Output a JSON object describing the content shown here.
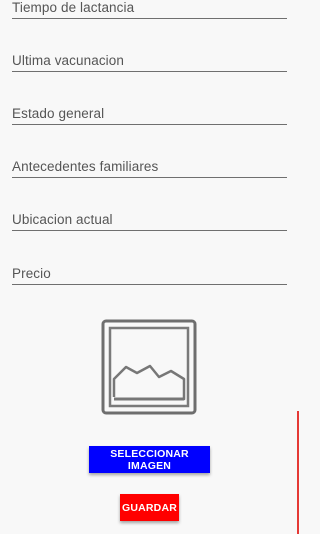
{
  "form": {
    "fields": [
      {
        "placeholder": "Tiempo de lactancia",
        "value": ""
      },
      {
        "placeholder": "Ultima vacunacion",
        "value": ""
      },
      {
        "placeholder": "Estado general",
        "value": ""
      },
      {
        "placeholder": "Antecedentes familiares",
        "value": ""
      },
      {
        "placeholder": "Ubicacion actual",
        "value": ""
      },
      {
        "placeholder": "Precio",
        "value": ""
      }
    ]
  },
  "image_preview": {
    "icon": "image-placeholder-icon"
  },
  "buttons": {
    "select_image_label": "SELECCIONAR IMAGEN",
    "save_label": "GUARDAR"
  },
  "colors": {
    "select_button": "#0000ff",
    "save_button": "#ff0000",
    "scroll_indicator": "#e53935"
  }
}
